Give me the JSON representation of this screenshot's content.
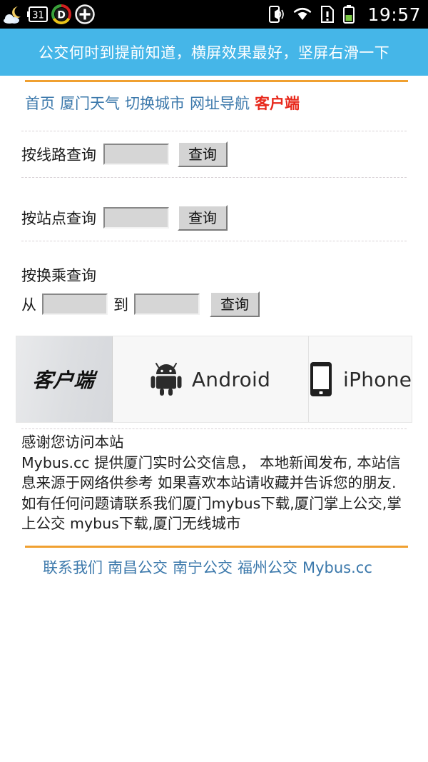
{
  "statusbar": {
    "clock": "19:57",
    "left_icons": [
      {
        "name": "weather-moon-cloud-icon"
      },
      {
        "name": "calendar-icon",
        "label": "31"
      },
      {
        "name": "dolphin-browser-d-icon",
        "label": "D"
      },
      {
        "name": "add-plus-circle-icon"
      }
    ],
    "right_icons": [
      {
        "name": "phone-vibrate-sound-icon"
      },
      {
        "name": "wifi-icon"
      },
      {
        "name": "sdcard-warning-icon"
      },
      {
        "name": "battery-icon"
      }
    ]
  },
  "banner": {
    "text": "公交何时到提前知道，横屏效果最好，坚屏右滑一下",
    "bg_color": "#45b6e8"
  },
  "nav": {
    "links": [
      {
        "label": "首页",
        "accent": false
      },
      {
        "label": "厦门天气",
        "accent": false
      },
      {
        "label": "切换城市",
        "accent": false
      },
      {
        "label": "网址导航",
        "accent": false
      },
      {
        "label": "客户端",
        "accent": true
      }
    ],
    "link_color": "#3b78ab",
    "accent_color": "#e8291c",
    "rule_color": "#f0a030"
  },
  "search": {
    "route": {
      "label": "按线路查询",
      "input_value": "",
      "input_placeholder": "",
      "button_label": "查询"
    },
    "stop": {
      "label": "按站点查询",
      "input_value": "",
      "input_placeholder": "",
      "button_label": "查询"
    },
    "transfer": {
      "heading": "按换乘查询",
      "from_label": "从",
      "from_value": "",
      "to_label": "到",
      "to_value": "",
      "button_label": "查询"
    }
  },
  "apps": {
    "client_label": "客户端",
    "android_label": "Android",
    "iphone_label": "iPhone"
  },
  "info": {
    "line1": "感谢您访问本站",
    "line2": "Mybus.cc 提供厦门实时公交信息， 本地新闻发布, 本站信息来源于网络供参考 如果喜欢本站请收藏并告诉您的朋友. 如有任何问题请联系我们厦门mybus下载,厦门掌上公交,掌上公交 mybus下载,厦门无线城市"
  },
  "footer": {
    "links": [
      {
        "label": "联系我们"
      },
      {
        "label": "南昌公交"
      },
      {
        "label": "南宁公交"
      },
      {
        "label": "福州公交"
      },
      {
        "label": "Mybus.cc"
      }
    ]
  }
}
